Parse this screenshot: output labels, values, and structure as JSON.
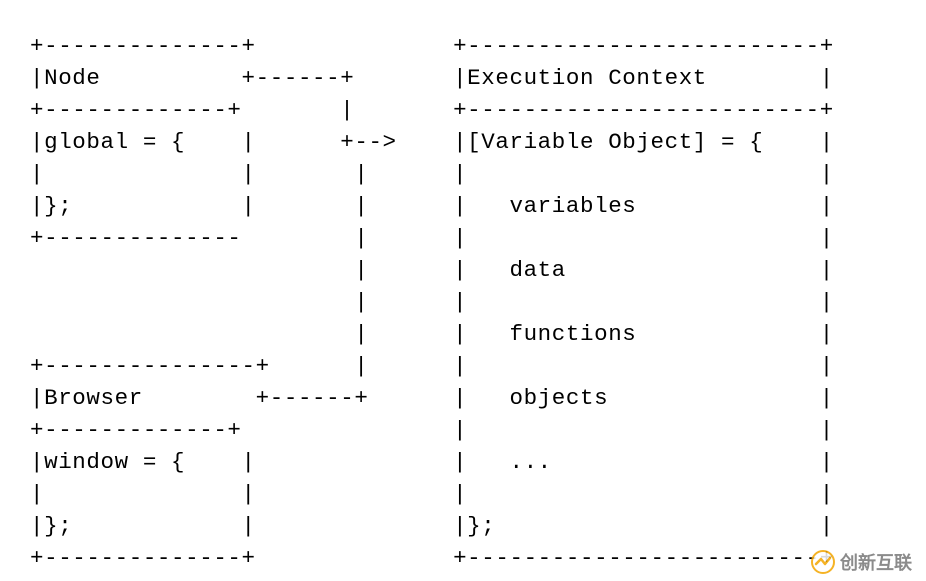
{
  "diagram": {
    "lines": [
      "+--------------+              +-------------------------+",
      "|Node          +------+       |Execution Context        |",
      "+-------------+       |       +-------------------------+",
      "|global = {    |      +-->    |[Variable Object] = {    |",
      "|              |       |      |                         |",
      "|};            |       |      |   variables             |",
      "+--------------        |      |                         |",
      "                       |      |   data                  |",
      "                       |      |                         |",
      "                       |      |   functions             |",
      "+---------------+      |      |                         |",
      "|Browser        +------+      |   objects               |",
      "+-------------+               |                         |",
      "|window = {    |              |   ...                   |",
      "|              |              |                         |",
      "|};            |              |};                       |",
      "+--------------+              +-------------------------+"
    ]
  },
  "watermark": {
    "text": "创新互联"
  }
}
